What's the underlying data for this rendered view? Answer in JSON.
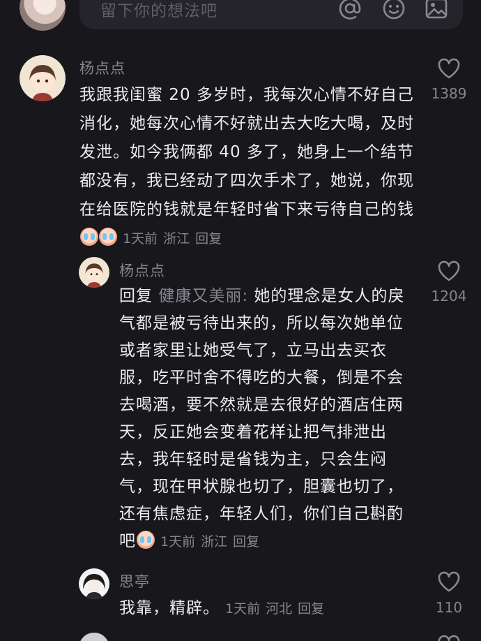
{
  "composer": {
    "placeholder": "留下你的想法吧",
    "icons": [
      "at-icon",
      "emoji-icon",
      "image-icon"
    ]
  },
  "comments": [
    {
      "username": "杨点点",
      "text": "我跟我闺蜜 20 多岁时，我每次心情不好自己消化，她每次心情不好就出去大吃大喝，及时发泄。如今我俩都 40 多了，她身上一个结节都没有，我已经动了四次手术了，她说，你现在给医院的钱就是年轻时省下来亏待自己的钱",
      "time": "1天前",
      "location": "浙江",
      "reply_label": "回复",
      "likes": "1389"
    },
    {
      "username": "杨点点",
      "reply_prefix": "回复",
      "reply_to": "健康又美丽:",
      "text": " 她的理念是女人的戾气都是被亏待出来的，所以每次她单位或者家里让她受气了，立马出去买衣服，吃平时舍不得吃的大餐，倒是不会去喝酒，要不然就是去很好的酒店住两天，反正她会变着花样让把气排泄出去，我年轻时是省钱为主，只会生闷气，现在甲状腺也切了，胆囊也切了，还有焦虑症，年轻人们，你们自己斟酌吧",
      "time": "1天前",
      "location": "浙江",
      "reply_label": "回复",
      "likes": "1204"
    },
    {
      "username": "思亭",
      "text": "我靠，精辟。",
      "time": "1天前",
      "location": "河北",
      "reply_label": "回复",
      "likes": "110"
    }
  ],
  "colors": {
    "background": "#18171c",
    "text": "#eceaef",
    "secondary": "#86858d"
  }
}
